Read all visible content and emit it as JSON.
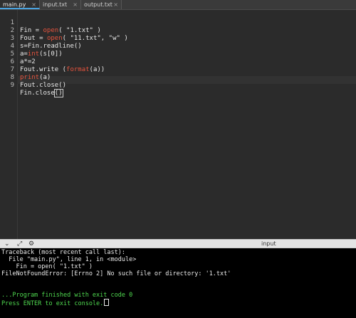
{
  "tabs": [
    {
      "label": "main.py",
      "active": true
    },
    {
      "label": "input.txt",
      "active": false
    },
    {
      "label": "output.txt",
      "active": false
    }
  ],
  "tab_close_glyph": "×",
  "editor": {
    "line_numbers": [
      "1",
      "2",
      "3",
      "4",
      "5",
      "6",
      "7",
      "8",
      "9"
    ],
    "lines": [
      {
        "a": "Fin = ",
        "kw": "open",
        "b": "( \"1.txt\" )"
      },
      {
        "a": "Fout = ",
        "kw": "open",
        "b": "( \"11.txt\", \"w\" )"
      },
      {
        "a": "s=Fin.readline()",
        "kw": "",
        "b": ""
      },
      {
        "a": "a=",
        "kw": "int",
        "b": "(s[0])"
      },
      {
        "a": "a*=2",
        "kw": "",
        "b": ""
      },
      {
        "a": "Fout.write (",
        "kw": "format",
        "b": "(a))"
      },
      {
        "a": "",
        "kw": "print",
        "b": "(a)"
      },
      {
        "a": "Fout.close()",
        "kw": "",
        "b": ""
      },
      {
        "a": "Fin.close",
        "kw": "",
        "b": "()"
      }
    ]
  },
  "console_header": {
    "icons": [
      "chevron-down-icon",
      "expand-icon",
      "settings-icon"
    ],
    "icon_glyphs": [
      "⌄",
      "⤢",
      "⚙"
    ],
    "input_label": "input"
  },
  "console": {
    "lines": [
      "Traceback (most recent call last):",
      "  File \"main.py\", line 1, in <module>",
      "    Fin = open( \"1.txt\" )",
      "FileNotFoundError: [Errno 2] No such file or directory: '1.txt'",
      "",
      "",
      "...Program finished with exit code 0",
      "Press ENTER to exit console."
    ]
  },
  "colors": {
    "editor_bg": "#2b2b2b",
    "keyword": "#e5533d",
    "console_bg": "#000000",
    "console_green": "#4fd84f",
    "active_tab_accent": "#4aa3df"
  }
}
